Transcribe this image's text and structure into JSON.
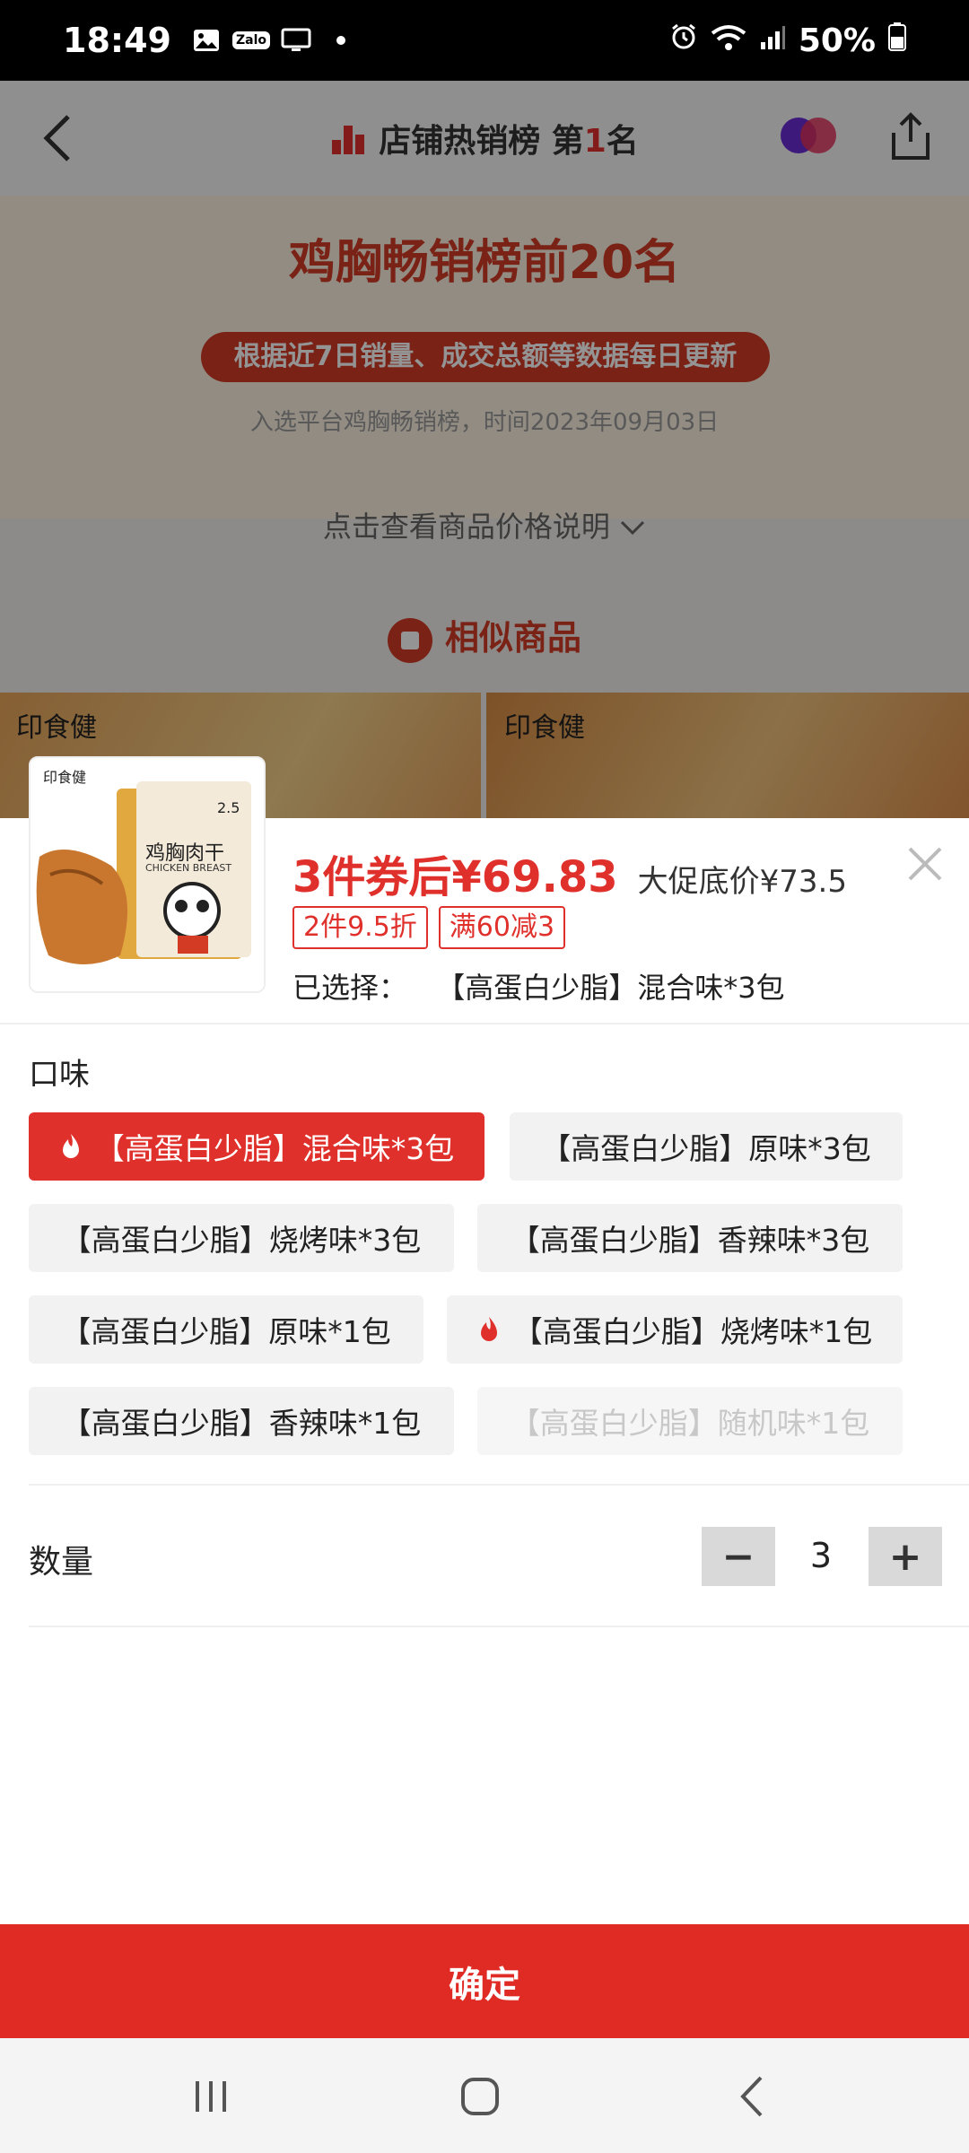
{
  "status_bar": {
    "time": "18:49",
    "battery": "50%"
  },
  "page_header": {
    "title_prefix": "店铺热销榜 第",
    "rank": "1",
    "title_suffix": "名"
  },
  "banner": {
    "title": "鸡胸畅销榜前20名",
    "pill_text": "根据近7日销量、成交总额等数据每日更新",
    "note": "入选平台鸡胸畅销榜，时间2023年09月03日",
    "price_note": "点击查看商品价格说明",
    "similar": "相似商品",
    "brand_left": "印食健",
    "brand_right": "印食健"
  },
  "product": {
    "image_brand": "印食健",
    "image_name": "鸡胸肉干",
    "image_en": "CHICKEN BREAST",
    "image_weight": "2.5",
    "coupon_price": "3件券后¥69.83",
    "promo_price": "大促底价¥73.5",
    "tags": [
      "2件9.5折",
      "满60减3"
    ],
    "selected_label": "已选择：",
    "selected_value": "【高蛋白少脂】混合味*3包"
  },
  "flavor": {
    "title": "口味",
    "options": [
      {
        "label": "【高蛋白少脂】混合味*3包",
        "state": "selected",
        "hot": true
      },
      {
        "label": "【高蛋白少脂】原味*3包",
        "state": "normal",
        "hot": false
      },
      {
        "label": "【高蛋白少脂】烧烤味*3包",
        "state": "normal",
        "hot": false
      },
      {
        "label": "【高蛋白少脂】香辣味*3包",
        "state": "normal",
        "hot": false
      },
      {
        "label": "【高蛋白少脂】原味*1包",
        "state": "normal",
        "hot": false
      },
      {
        "label": "【高蛋白少脂】烧烤味*1包",
        "state": "normal",
        "hot": true
      },
      {
        "label": "【高蛋白少脂】香辣味*1包",
        "state": "normal",
        "hot": false
      },
      {
        "label": "【高蛋白少脂】随机味*1包",
        "state": "disabled",
        "hot": false
      }
    ]
  },
  "quantity": {
    "label": "数量",
    "value": "3",
    "minus": "−",
    "plus": "+"
  },
  "confirm_button": "确定",
  "colors": {
    "accent": "#e0302b",
    "confirm": "#e02a24",
    "option_bg": "#f2f2f2"
  }
}
